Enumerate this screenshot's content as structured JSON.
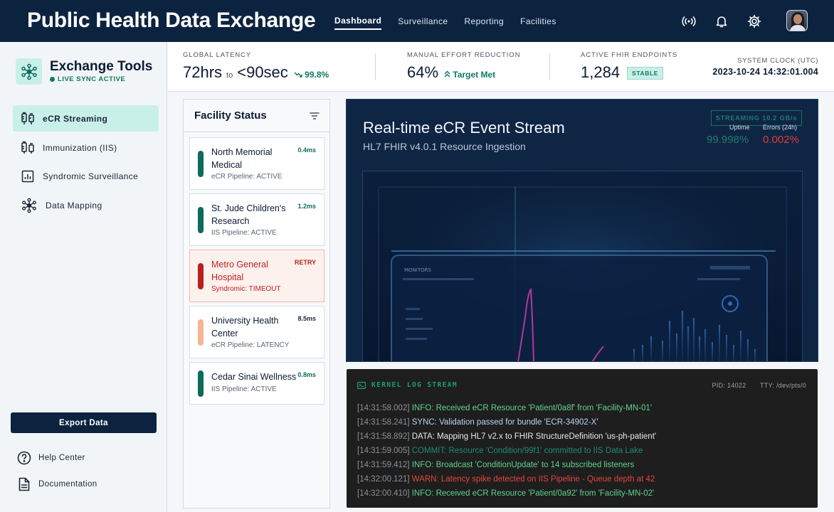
{
  "app": {
    "title": "Public Health Data Exchange"
  },
  "nav": [
    {
      "label": "Dashboard",
      "active": true
    },
    {
      "label": "Surveillance",
      "active": false
    },
    {
      "label": "Reporting",
      "active": false
    },
    {
      "label": "Facilities",
      "active": false
    }
  ],
  "top_icons": [
    "broadcast-icon",
    "bell-icon",
    "gear-icon",
    "avatar"
  ],
  "sidebar": {
    "title": "Exchange Tools",
    "subtitle": "LIVE SYNC ACTIVE",
    "items": [
      {
        "label": "eCR Streaming",
        "icon": "syringe-icon",
        "active": true
      },
      {
        "label": "Immunization (IIS)",
        "icon": "vial-icon",
        "active": false
      },
      {
        "label": "Syndromic Surveillance",
        "icon": "bar-chart-icon",
        "active": false
      },
      {
        "label": "Data Mapping",
        "icon": "network-icon",
        "active": false
      }
    ],
    "export_label": "Export Data",
    "links": [
      {
        "label": "Help Center",
        "icon": "help-icon"
      },
      {
        "label": "Documentation",
        "icon": "document-icon"
      }
    ]
  },
  "metrics": {
    "latency": {
      "label": "GLOBAL LATENCY",
      "from": "72hrs",
      "to_word": "to",
      "to": "<90sec",
      "delta": "99.8%"
    },
    "effort": {
      "label": "MANUAL EFFORT REDUCTION",
      "value": "64%",
      "delta": "Target Met"
    },
    "endpoints": {
      "label": "ACTIVE FHIR ENDPOINTS",
      "value": "1,284",
      "badge": "STABLE"
    },
    "clock": {
      "label": "SYSTEM CLOCK (UTC)",
      "value": "2023-10-24 14:32:01.004"
    }
  },
  "facility_status": {
    "title": "Facility Status",
    "facilities": [
      {
        "name": "North Memorial Medical",
        "status": "eCR Pipeline: ACTIVE",
        "metric": "0.4ms",
        "color": "#0d6b5a",
        "alert": false
      },
      {
        "name": "St. Jude Children's Research",
        "status": "IIS Pipeline: ACTIVE",
        "metric": "1.2ms",
        "color": "#0d6b5a",
        "alert": false
      },
      {
        "name": "Metro General Hospital",
        "status": "Syndromic: TIMEOUT",
        "metric": "RETRY",
        "color": "#b8201c",
        "alert": true
      },
      {
        "name": "University Health Center",
        "status": "eCR Pipeline: LATENCY",
        "metric": "8.5ms",
        "color": "#f5b596",
        "alert": false
      },
      {
        "name": "Cedar Sinai Wellness",
        "status": "IIS Pipeline: ACTIVE",
        "metric": "0.8ms",
        "color": "#0d6b5a",
        "alert": false
      }
    ]
  },
  "stream": {
    "title": "Real-time eCR Event Stream",
    "subtitle": "HL7 FHIR v4.0.1 Resource Ingestion",
    "badge": "STREAMING 10.2 GB/s",
    "uptime_label": "Uptime",
    "uptime_value": "99.998%",
    "errors_label": "Errors (24h)",
    "errors_value": "0.002%"
  },
  "log": {
    "title": "KERNEL LOG STREAM",
    "pid": "PID: 14022",
    "tty": "TTY: /dev/pts/0",
    "lines": [
      {
        "ts": "[14:31:58.002]",
        "msg": "INFO: Received eCR Resource 'Patient/0a8f' from 'Facility-MN-01'",
        "color": "#5fd38c"
      },
      {
        "ts": "[14:31:58.241]",
        "msg": "SYNC: Validation passed for bundle 'ECR-34902-X'",
        "color": "#b9d4f2"
      },
      {
        "ts": "[14:31:58.892]",
        "msg": "DATA: Mapping HL7 v2.x to FHIR StructureDefinition 'us-ph-patient'",
        "color": "#e8e8e8"
      },
      {
        "ts": "[14:31:59.005]",
        "msg": "COMMIT: Resource 'Condition/99f1' committed to IIS Data Lake",
        "color": "#1d8a72"
      },
      {
        "ts": "[14:31:59.412]",
        "msg": "INFO: Broadcast 'ConditionUpdate' to 14 subscribed listeners",
        "color": "#5fd38c"
      },
      {
        "ts": "[14:32:00.121]",
        "msg": "WARN: Latency spike detected on IIS Pipeline - Queue depth at 42",
        "color": "#e2463a"
      },
      {
        "ts": "[14:32:00.410]",
        "msg": "INFO: Received eCR Resource 'Patient/0a92' from 'Facility-MN-02'",
        "color": "#5fd38c"
      }
    ]
  }
}
